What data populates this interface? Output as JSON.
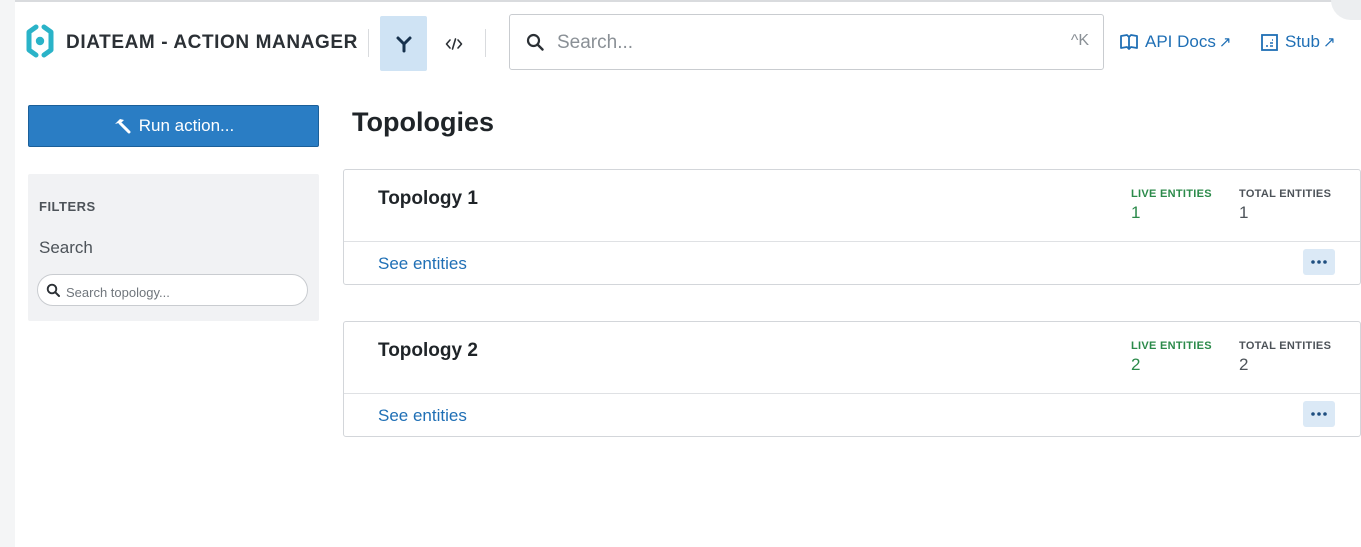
{
  "header": {
    "app_title": "DIATEAM - ACTION MANAGER",
    "search": {
      "placeholder": "Search...",
      "shortcut": "^K"
    },
    "links": {
      "api_docs": "API Docs",
      "stub": "Stub",
      "external_mark": "↗"
    }
  },
  "sidebar": {
    "run_action_label": "Run action...",
    "filters": {
      "title": "FILTERS",
      "search_label": "Search",
      "search_placeholder": "Search topology..."
    }
  },
  "main": {
    "title": "Topologies",
    "topologies": [
      {
        "name": "Topology 1",
        "live_label": "LIVE ENTITIES",
        "live_value": "1",
        "total_label": "TOTAL ENTITIES",
        "total_value": "1",
        "link": "See entities"
      },
      {
        "name": "Topology 2",
        "live_label": "LIVE ENTITIES",
        "live_value": "2",
        "total_label": "TOTAL ENTITIES",
        "total_value": "2",
        "link": "See entities"
      }
    ]
  },
  "colors": {
    "accent": "#2a7dc4",
    "link": "#1f6fb5",
    "live": "#2b8a4a",
    "logo": "#2ab3c8",
    "active_tool_bg": "#cfe3f4"
  },
  "icons": {
    "logo": "logo-icon",
    "topology_tool": "fork-icon",
    "code_tool": "code-icon",
    "search": "search-icon",
    "api_docs": "book-icon",
    "stub": "document-icon",
    "run": "hammer-icon",
    "more": "ellipsis-icon"
  }
}
